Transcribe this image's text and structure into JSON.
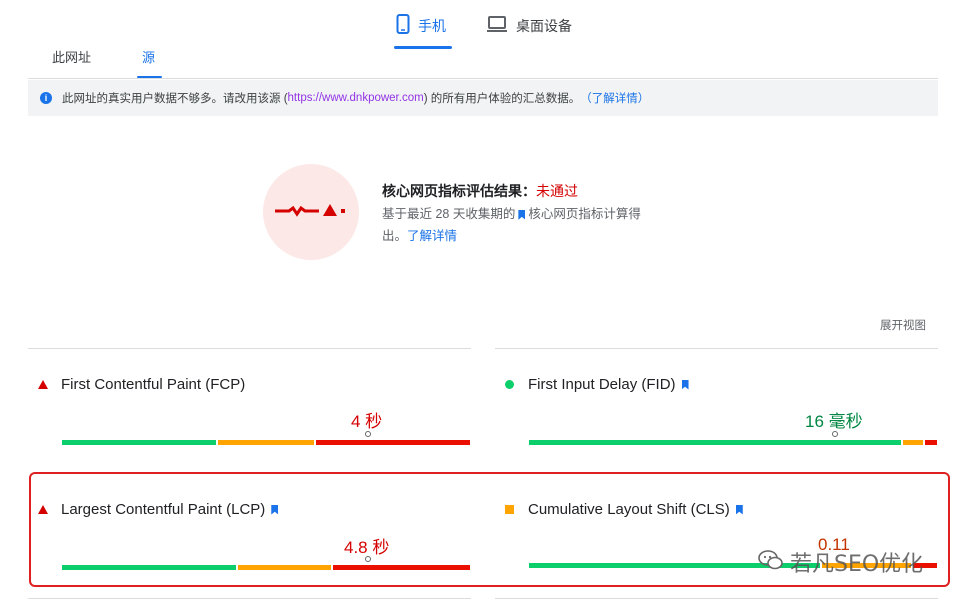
{
  "device_tabs": [
    {
      "label": "手机",
      "icon": "phone-icon",
      "active": true
    },
    {
      "label": "桌面设备",
      "icon": "laptop-icon",
      "active": false
    }
  ],
  "source_tabs": [
    {
      "label": "此网址",
      "active": false
    },
    {
      "label": "源",
      "active": true
    }
  ],
  "banner": {
    "text_before": "此网址的真实用户数据不够多。请改用该源 (",
    "link": "https://www.dnkpower.com",
    "text_after": ") 的所有用户体验的汇总数据。",
    "learn_more": "（了解详情）"
  },
  "assessment": {
    "title": "核心网页指标评估结果：",
    "result": "未通过",
    "desc_before": "基于最近 28 天收集期的",
    "desc_mid": "核心网页指标计算得",
    "desc_end": "出。",
    "learn_more": "了解详情",
    "colors": {
      "fail": "#d50000",
      "circle_bg": "#fce8e6"
    }
  },
  "expand_view": "展开视图",
  "metrics": [
    {
      "name": "First Contentful Paint (FCP)",
      "status": "poor",
      "value": "4 秒",
      "value_color": "#d50000",
      "core": false,
      "distribution": [
        0.38,
        0.24,
        0.38
      ],
      "marker_fraction": 0.75
    },
    {
      "name": "First Input Delay (FID)",
      "status": "good",
      "value": "16 毫秒",
      "value_color": "#018642",
      "core": true,
      "distribution": [
        0.92,
        0.05,
        0.03
      ],
      "marker_fraction": 0.74
    },
    {
      "name": "Largest Contentful Paint (LCP)",
      "status": "poor",
      "value": "4.8 秒",
      "value_color": "#d50000",
      "core": true,
      "distribution": [
        0.43,
        0.23,
        0.34
      ],
      "marker_fraction": 0.75
    },
    {
      "name": "Cumulative Layout Shift (CLS)",
      "status": "needs-improvement",
      "value": "0.11",
      "value_color": "#c33300",
      "core": true,
      "distribution": [
        0.72,
        0.22,
        0.06
      ],
      "marker_fraction": 0.74
    }
  ],
  "watermark": "若凡SEO优化"
}
